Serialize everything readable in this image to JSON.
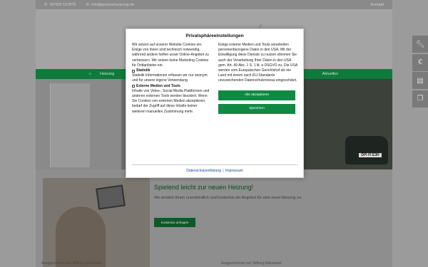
{
  "topbar": {
    "phone": "06762/ 1578?5",
    "email": "info@gruenerheizung.de",
    "kontakt": "Kontakt"
  },
  "nav": {
    "items": [
      "Heizung",
      "Aktuelles"
    ]
  },
  "hero": {
    "plate": "DPi FI E3H"
  },
  "promo": {
    "title": "Spielend leicht zur neuen Heizung!",
    "text": "Wir senden Ihnen unverbindlich und kostenlos ein Angebot für eine neue Heizung zu.",
    "button": "Kostenlos anfragen"
  },
  "bottom": {
    "left": "Ausgezeichnet von Stiftung Warentest",
    "right": "Ausgezeichnet von Stiftung Warentest"
  },
  "modal": {
    "title": "Privatsphäreeinstellungen",
    "left_intro": "Wir setzen auf unserer Website Cookies ein. Einige von ihnen sind technisch notwendig, während andere helfen unser Online-Angebot zu verbessern. Wir setzen keine Marketing Cookies für Drittanbieter ein.",
    "stat_label": "Statistik",
    "stat_text": "Statistik Informationen erfassen wir nur anonym und für unsere eigene Verwendung.",
    "ext_label": "Externe Medien und Tools",
    "ext_text": "Inhalte von Video-, Social Media Plattformen und anderen externen Tools werden blockiert. Wenn Sie Cookies von externen Medien akzeptieren, bedarf der Zugriff auf diese Inhalte keiner weiteren manuellen Zustimmung mehr.",
    "right_text": "Einige externe Medien und Tools verarbeiten personenbezogene Daten in den USA. Mit der Einwilligung diese Dienste zu nutzen stimmen Sie auch der Verarbeitung Ihrer Daten in den USA gem. Art. 49 Abs. 1 S. 1 lit. a DSGVO zu. Die USA werden vom Europäischen Gerichtshof als ein Land mit einem nach EU-Standards unzureichenden Datenschutzniveau eingeschätzt.",
    "accept_all": "Alle akzeptieren",
    "save": "Speichern",
    "privacy_link": "Datenschutzerklärung",
    "separator": "|",
    "imprint_link": "Impressum"
  },
  "colors": {
    "brand_green": "#0f8a43",
    "nav_green": "#0f7a3b",
    "link_blue": "#1a3f9c"
  },
  "icons": [
    "phone-icon",
    "mail-icon",
    "home-icon",
    "wrench-icon",
    "euro-icon",
    "chat-icon",
    "copy-icon"
  ]
}
